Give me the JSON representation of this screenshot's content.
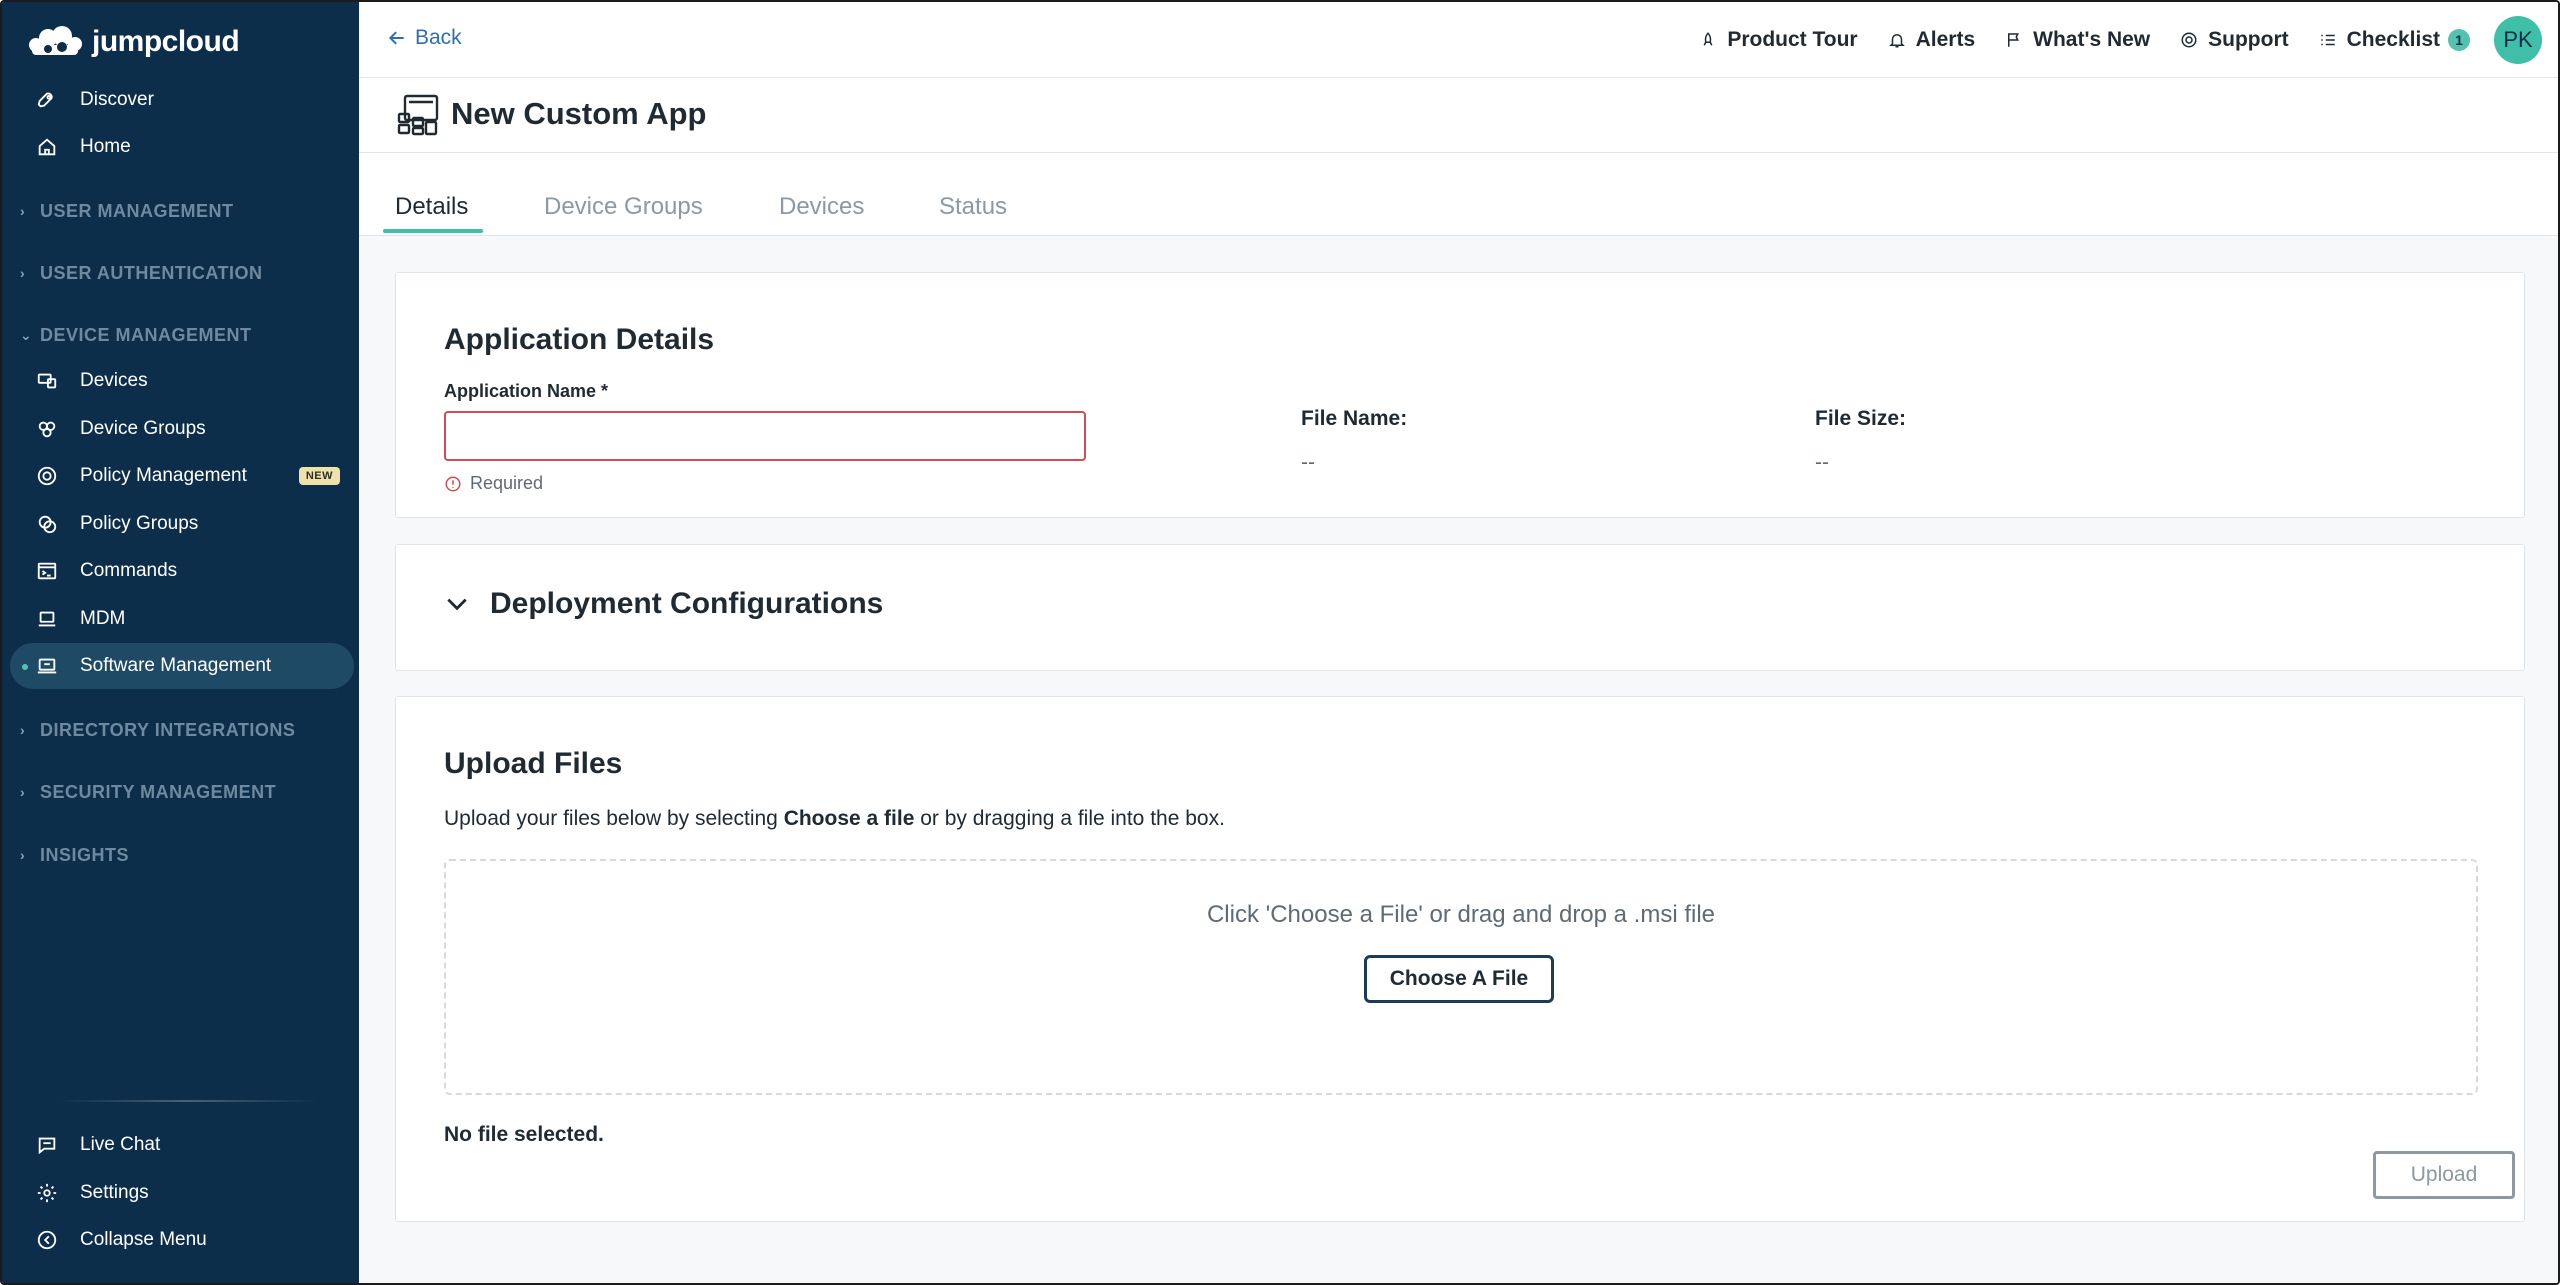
{
  "brand": {
    "name": "jumpcloud",
    "accent": "#3fbfa8",
    "sidebar_bg": "#0c2e4a",
    "error": "#d24b55"
  },
  "sidebar": {
    "top_items": [
      {
        "label": "Discover",
        "icon": "rocket-icon"
      },
      {
        "label": "Home",
        "icon": "home-icon"
      }
    ],
    "sections": {
      "user_management": "USER MANAGEMENT",
      "user_authentication": "USER AUTHENTICATION",
      "device_management": "DEVICE MANAGEMENT",
      "directory_integrations": "DIRECTORY INTEGRATIONS",
      "security_management": "SECURITY MANAGEMENT",
      "insights": "INSIGHTS"
    },
    "device_items": [
      {
        "label": "Devices",
        "icon": "devices-icon"
      },
      {
        "label": "Device Groups",
        "icon": "device-groups-icon"
      },
      {
        "label": "Policy Management",
        "icon": "policy-icon",
        "badge": "NEW"
      },
      {
        "label": "Policy Groups",
        "icon": "policy-groups-icon"
      },
      {
        "label": "Commands",
        "icon": "terminal-icon"
      },
      {
        "label": "MDM",
        "icon": "laptop-icon"
      },
      {
        "label": "Software Management",
        "icon": "software-icon",
        "active": true
      }
    ],
    "bottom_items": [
      {
        "label": "Live Chat",
        "icon": "chat-icon"
      },
      {
        "label": "Settings",
        "icon": "gear-icon"
      },
      {
        "label": "Collapse Menu",
        "icon": "collapse-icon"
      }
    ]
  },
  "topbar": {
    "back_label": "Back",
    "links": [
      {
        "label": "Product Tour",
        "icon": "rocket-icon"
      },
      {
        "label": "Alerts",
        "icon": "bell-icon"
      },
      {
        "label": "What's New",
        "icon": "flag-icon"
      },
      {
        "label": "Support",
        "icon": "lifebuoy-icon"
      },
      {
        "label": "Checklist",
        "icon": "checklist-icon"
      }
    ],
    "checklist_count": "1",
    "avatar_initials": "PK"
  },
  "page": {
    "title": "New Custom App"
  },
  "tabs": [
    {
      "label": "Details",
      "active": true
    },
    {
      "label": "Device Groups"
    },
    {
      "label": "Devices"
    },
    {
      "label": "Status"
    }
  ],
  "app_details": {
    "title": "Application Details",
    "name_label": "Application Name *",
    "name_value": "",
    "name_error": "Required",
    "file_name_label": "File Name:",
    "file_name_value": "--",
    "file_size_label": "File Size:",
    "file_size_value": "--"
  },
  "deployment": {
    "title": "Deployment Configurations"
  },
  "upload": {
    "title": "Upload Files",
    "desc_before": "Upload your files below by selecting ",
    "desc_bold": "Choose a file",
    "desc_after": " or by dragging a file into the box.",
    "drop_hint": "Click 'Choose a File' or drag and drop a .msi file",
    "choose_button": "Choose A File",
    "status": "No file selected.",
    "upload_button": "Upload"
  }
}
